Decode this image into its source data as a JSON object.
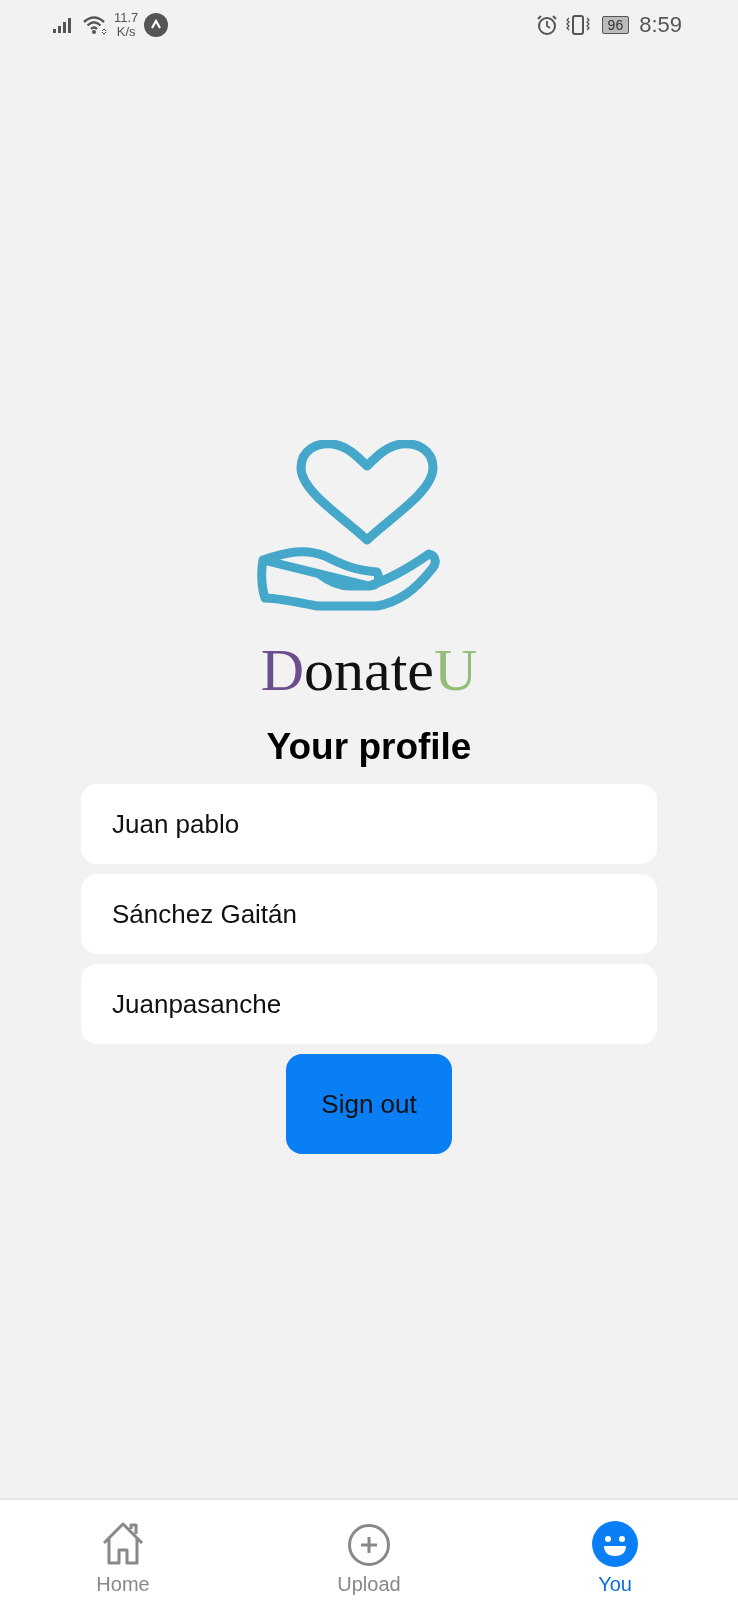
{
  "status_bar": {
    "speed_value": "11.7",
    "speed_unit": "K/s",
    "battery": "96",
    "time": "8:59"
  },
  "logo": {
    "parts": [
      {
        "text": "D",
        "color": "#6b4f8c"
      },
      {
        "text": "onate",
        "color": "#111111"
      },
      {
        "text": "U",
        "color": "#94bd7a"
      }
    ]
  },
  "title": "Your profile",
  "fields": [
    {
      "value": "Juan pablo"
    },
    {
      "value": "Sánchez Gaitán"
    },
    {
      "value": "Juanpasanche"
    }
  ],
  "sign_out_button": "Sign out",
  "bottom_nav": [
    {
      "label": "Home",
      "kind": "home",
      "selected": false
    },
    {
      "label": "Upload",
      "kind": "upload",
      "selected": false
    },
    {
      "label": "You",
      "kind": "you",
      "selected": true
    }
  ]
}
